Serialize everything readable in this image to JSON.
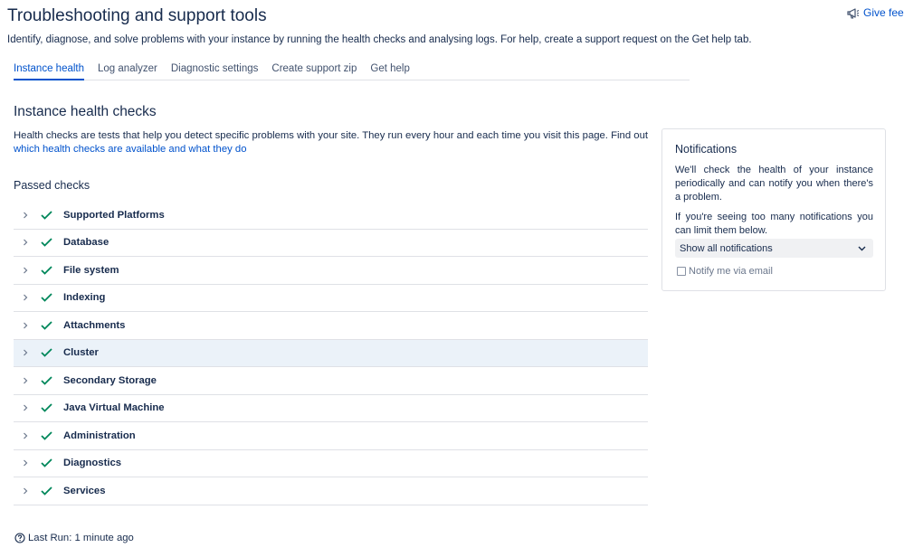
{
  "header": {
    "title": "Troubleshooting and support tools",
    "feedback_label": "Give feed",
    "subtitle": "Identify, diagnose, and solve problems with your instance by running the health checks and analysing logs. For help, create a support request on the Get help tab."
  },
  "tabs": [
    {
      "label": "Instance health",
      "active": true
    },
    {
      "label": "Log analyzer",
      "active": false
    },
    {
      "label": "Diagnostic settings",
      "active": false
    },
    {
      "label": "Create support zip",
      "active": false
    },
    {
      "label": "Get help",
      "active": false
    }
  ],
  "main": {
    "section_title": "Instance health checks",
    "description": "Health checks are tests that help you detect specific problems with your site. They run every hour and each time you visit this page. Find out",
    "description_link": "which health checks are available and what they do",
    "passed_title": "Passed checks",
    "checks": [
      {
        "label": "Supported Platforms"
      },
      {
        "label": "Database"
      },
      {
        "label": "File system"
      },
      {
        "label": "Indexing"
      },
      {
        "label": "Attachments"
      },
      {
        "label": "Cluster"
      },
      {
        "label": "Secondary Storage"
      },
      {
        "label": "Java Virtual Machine"
      },
      {
        "label": "Administration"
      },
      {
        "label": "Diagnostics"
      },
      {
        "label": "Services"
      }
    ],
    "last_run": "Last Run: 1 minute ago"
  },
  "notifications": {
    "title": "Notifications",
    "text1": "We'll check the health of your instance periodically and can notify you when there's a problem.",
    "text2": "If you're seeing too many notifications you can limit them below.",
    "select_value": "Show all notifications",
    "email_label": "Notify me via email",
    "email_checked": false
  },
  "colors": {
    "link": "#0052cc",
    "success": "#00875a",
    "text": "#172b4d",
    "highlight_row": "#ebf2f9"
  }
}
